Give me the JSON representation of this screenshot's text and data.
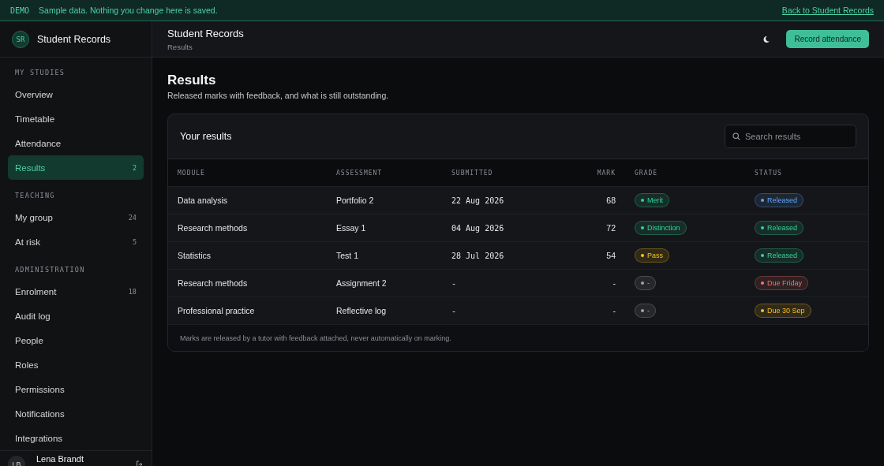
{
  "banner": {
    "tag": "DEMO",
    "message": "Sample data. Nothing you change here is saved.",
    "link": "Back to Student Records"
  },
  "sidebar": {
    "logo": "SR",
    "app_name": "Student Records",
    "sections": [
      {
        "title": "MY STUDIES",
        "items": [
          {
            "label": "Overview",
            "selected": false
          },
          {
            "label": "Timetable",
            "selected": false
          },
          {
            "label": "Attendance",
            "selected": false
          },
          {
            "label": "Results",
            "count": "2",
            "selected": true
          }
        ]
      },
      {
        "title": "TEACHING",
        "items": [
          {
            "label": "My group",
            "count": "24",
            "selected": false
          },
          {
            "label": "At risk",
            "count": "5",
            "selected": false
          }
        ]
      },
      {
        "title": "ADMINISTRATION",
        "items": [
          {
            "label": "Enrolment",
            "count": "18",
            "selected": false
          },
          {
            "label": "Audit log",
            "selected": false
          },
          {
            "label": "People",
            "selected": false
          },
          {
            "label": "Roles",
            "selected": false
          },
          {
            "label": "Permissions",
            "selected": false
          },
          {
            "label": "Notifications",
            "selected": false
          },
          {
            "label": "Integrations",
            "selected": false
          }
        ]
      }
    ],
    "user": {
      "initials": "LB",
      "name": "Lena Brandt"
    }
  },
  "header": {
    "title": "Student Records",
    "breadcrumb": "Results",
    "button": "Record attendance"
  },
  "page": {
    "title": "Results",
    "subtitle": "Released marks with feedback, and what is still outstanding."
  },
  "card": {
    "title": "Your results",
    "search": {
      "placeholder": "Search results"
    },
    "table": {
      "columns": [
        "MODULE",
        "ASSESSMENT",
        "SUBMITTED",
        "MARK",
        "GRADE",
        "STATUS"
      ],
      "rows": [
        {
          "module": "Data analysis",
          "assessment": "Portfolio 2",
          "submitted": "22 Aug 2026",
          "mark": "68",
          "grade": {
            "label": "Merit",
            "color": "#34d399"
          },
          "status": {
            "label": "Released",
            "color": "#60a5fa"
          }
        },
        {
          "module": "Research methods",
          "assessment": "Essay 1",
          "submitted": "04 Aug 2026",
          "mark": "72",
          "grade": {
            "label": "Distinction",
            "color": "#34d399"
          },
          "status": {
            "label": "Released",
            "color": "#34d399"
          }
        },
        {
          "module": "Statistics",
          "assessment": "Test 1",
          "submitted": "28 Jul 2026",
          "mark": "54",
          "grade": {
            "label": "Pass",
            "color": "#fbbf24"
          },
          "status": {
            "label": "Released",
            "color": "#34d399"
          }
        },
        {
          "module": "Research methods",
          "assessment": "Assignment 2",
          "submitted": "-",
          "mark": "-",
          "grade": {
            "label": "-",
            "color": "#a1a1aa"
          },
          "status": {
            "label": "Due Friday",
            "color": "#f87171"
          }
        },
        {
          "module": "Professional practice",
          "assessment": "Reflective log",
          "submitted": "-",
          "mark": "-",
          "grade": {
            "label": "-",
            "color": "#a1a1aa"
          },
          "status": {
            "label": "Due 30 Sep",
            "color": "#fbbf24"
          }
        }
      ]
    },
    "footnote": "Marks are released by a tutor with feedback attached, never automatically on marking."
  }
}
